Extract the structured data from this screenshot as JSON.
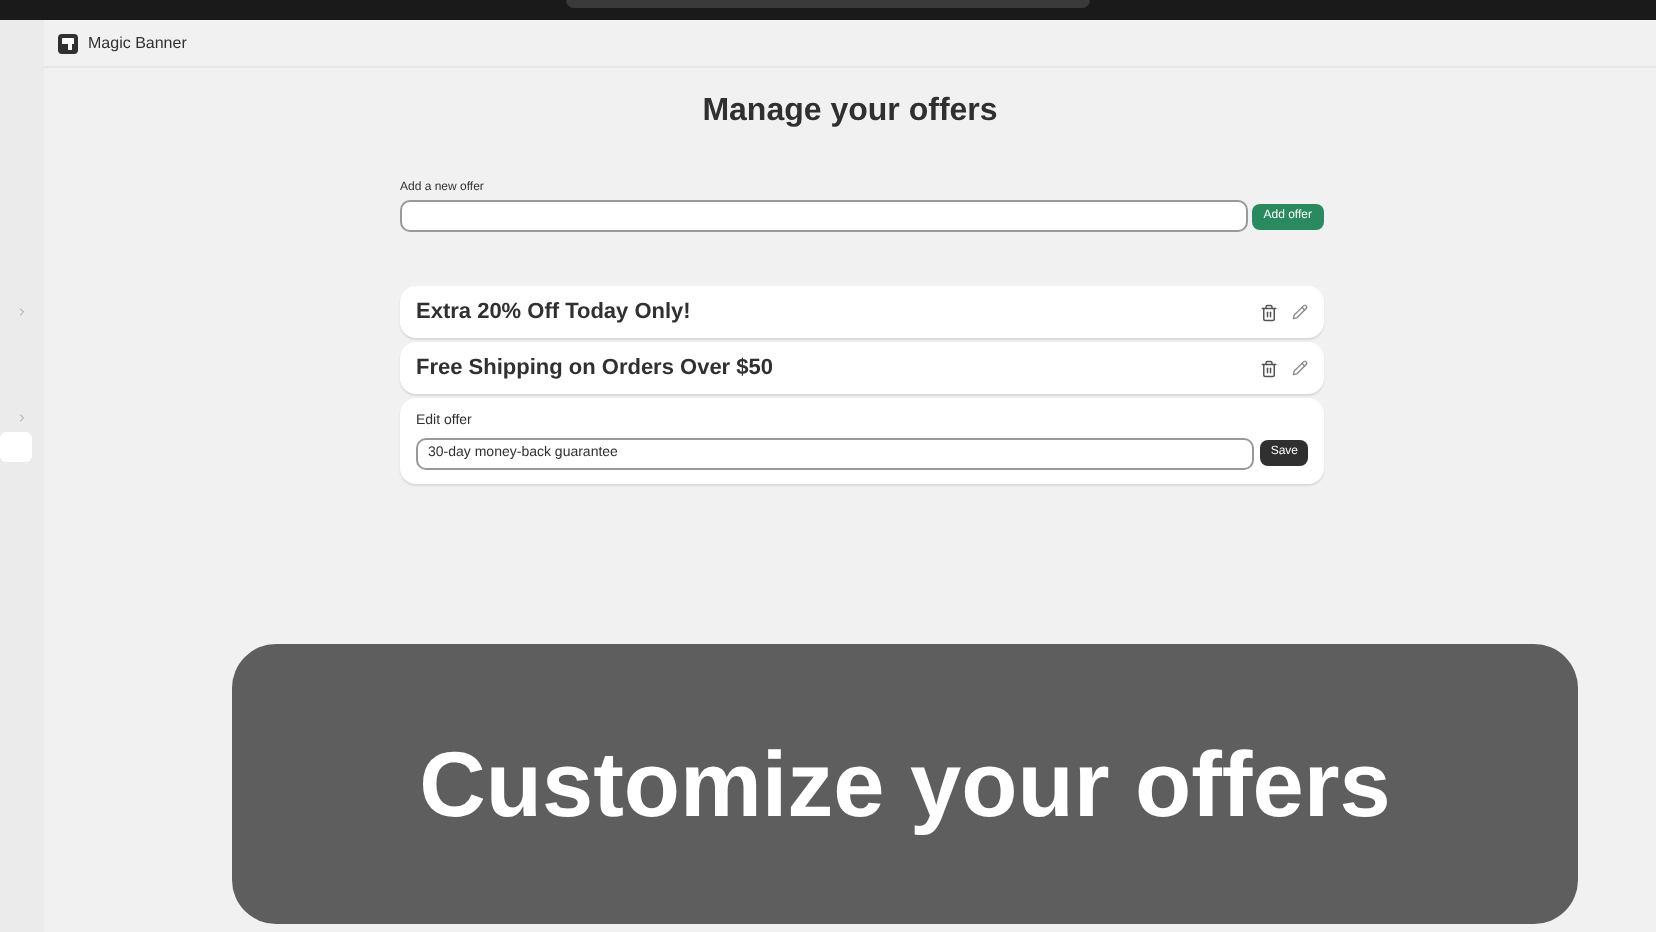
{
  "app": {
    "title": "Magic Banner"
  },
  "page": {
    "title": "Manage your offers"
  },
  "new_offer": {
    "label": "Add a new offer",
    "button": "Add offer"
  },
  "offers": [
    {
      "kind": "offer",
      "text": "Extra 20% Off Today Only!"
    },
    {
      "kind": "offer",
      "text": "Free Shipping on Orders Over $50"
    },
    {
      "kind": "editing",
      "label": "Edit offer",
      "value": "30-day money-back guarantee",
      "button": "Save"
    }
  ],
  "caption": "Customize your offers"
}
